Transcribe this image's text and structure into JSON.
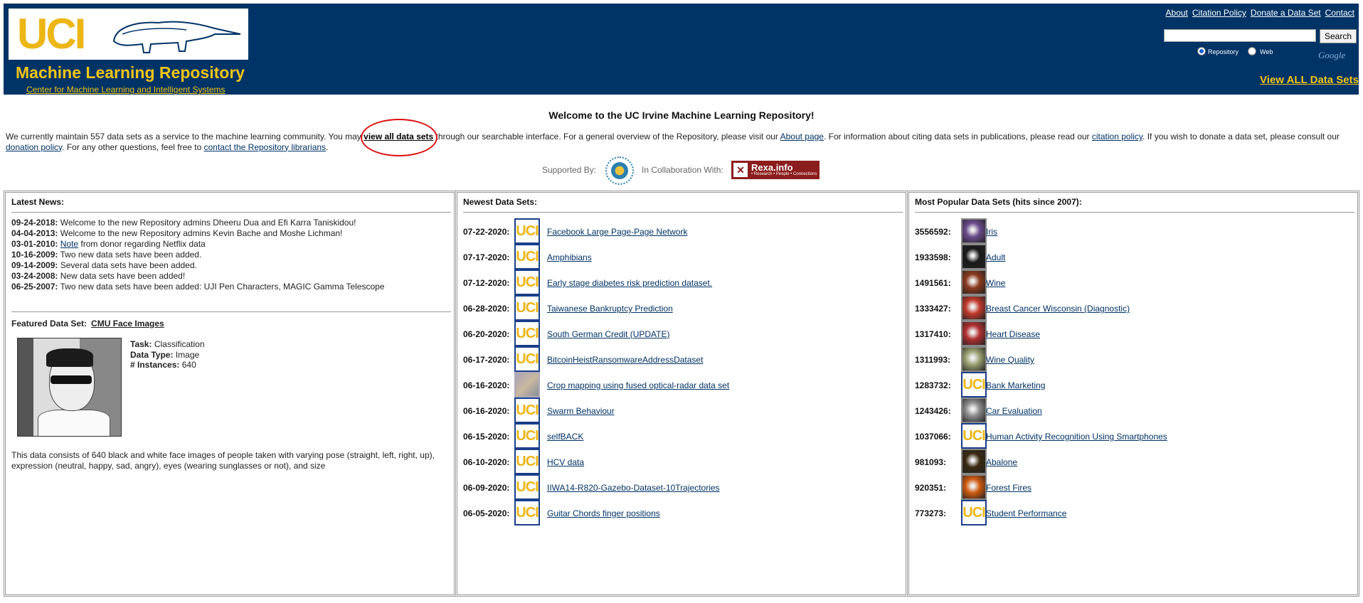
{
  "header": {
    "logo_text": "UCI",
    "title": "Machine Learning Repository",
    "subtitle": "Center for Machine Learning and Intelligent Systems",
    "links": [
      "About",
      "Citation Policy",
      "Donate a Data Set",
      "Contact"
    ],
    "search": {
      "button": "Search",
      "radio_repository": "Repository",
      "radio_web": "Web",
      "google": "Google"
    },
    "view_all": "View ALL Data Sets"
  },
  "welcome": "Welcome to the UC Irvine Machine Learning Repository!",
  "intro": {
    "t1": "We currently maintain 557 data sets as a service to the machine learning community. You may ",
    "link1": "view all data sets",
    "t2": " through our searchable interface. For a general overview of the Repository, please visit our ",
    "link2": "About page",
    "t3": ". For information about citing data sets in publications, please read our ",
    "link3": "citation policy",
    "t4": ". If you wish to donate a data set, please consult our ",
    "link4": "donation policy",
    "t5": ". For any other questions, feel free to ",
    "link5": "contact the Repository librarians",
    "t6": "."
  },
  "support": {
    "supported_by": "Supported By:",
    "collab": "In Collaboration With:",
    "rexa_title": "Rexa.info",
    "rexa_sub": "• Research • People • Connections"
  },
  "news": {
    "title": "Latest News:",
    "items": [
      {
        "date": "09-24-2018:",
        "text": " Welcome to the new Repository admins Dheeru Dua and Efi Karra Taniskidou!"
      },
      {
        "date": "04-04-2013:",
        "text": " Welcome to the new Repository admins Kevin Bache and Moshe Lichman!"
      },
      {
        "date": "03-01-2010:",
        "link": "Note",
        "text": " from donor regarding Netflix data"
      },
      {
        "date": "10-16-2009:",
        "text": " Two new data sets have been added."
      },
      {
        "date": "09-14-2009:",
        "text": " Several data sets have been added."
      },
      {
        "date": "03-24-2008:",
        "text": " New data sets have been added!"
      },
      {
        "date": "06-25-2007:",
        "text": " Two new data sets have been added: UJI Pen Characters, MAGIC Gamma Telescope"
      }
    ]
  },
  "featured": {
    "label": "Featured Data Set:",
    "name": "CMU Face Images",
    "task_label": "Task:",
    "task": "Classification",
    "type_label": "Data Type:",
    "type": "Image",
    "inst_label": "# Instances:",
    "instances": "640",
    "description": "This data consists of 640 black and white face images of people taken with varying pose (straight, left, right, up), expression (neutral, happy, sad, angry), eyes (wearing sunglasses or not), and size"
  },
  "newest": {
    "title": "Newest Data Sets:",
    "items": [
      {
        "date": "07-22-2020:",
        "name": "Facebook Large Page-Page Network",
        "thumb": "uci"
      },
      {
        "date": "07-17-2020:",
        "name": "Amphibians",
        "thumb": "uci"
      },
      {
        "date": "07-12-2020:",
        "name": "Early stage diabetes risk prediction dataset.",
        "thumb": "uci"
      },
      {
        "date": "06-28-2020:",
        "name": "Taiwanese Bankruptcy Prediction",
        "thumb": "uci"
      },
      {
        "date": "06-20-2020:",
        "name": "South German Credit (UPDATE)",
        "thumb": "uci"
      },
      {
        "date": "06-17-2020:",
        "name": "BitcoinHeistRansomwareAddressDataset",
        "thumb": "uci"
      },
      {
        "date": "06-16-2020:",
        "name": "Crop mapping using fused optical-radar data set",
        "thumb": "crop-image"
      },
      {
        "date": "06-16-2020:",
        "name": "Swarm Behaviour",
        "thumb": "uci"
      },
      {
        "date": "06-15-2020:",
        "name": "selfBACK",
        "thumb": "uci"
      },
      {
        "date": "06-10-2020:",
        "name": "HCV data",
        "thumb": "uci"
      },
      {
        "date": "06-09-2020:",
        "name": "IIWA14-R820-Gazebo-Dataset-10Trajectories",
        "thumb": "uci"
      },
      {
        "date": "06-05-2020:",
        "name": "Guitar Chords finger positions",
        "thumb": "uci"
      }
    ]
  },
  "popular": {
    "title": "Most Popular Data Sets (hits since 2007):",
    "items": [
      {
        "hits": "3556592:",
        "name": "Iris",
        "thumb": "iris-image",
        "color": "#6b4c8c"
      },
      {
        "hits": "1933598:",
        "name": "Adult",
        "thumb": "adult-image",
        "color": "#1a1a1a"
      },
      {
        "hits": "1491561:",
        "name": "Wine",
        "thumb": "wine-image",
        "color": "#8a3a1e"
      },
      {
        "hits": "1333427:",
        "name": "Breast Cancer Wisconsin (Diagnostic)",
        "thumb": "tree-image",
        "color": "#c0392b"
      },
      {
        "hits": "1317410:",
        "name": "Heart Disease",
        "thumb": "heart-image",
        "color": "#b03030"
      },
      {
        "hits": "1311993:",
        "name": "Wine Quality",
        "thumb": "wine-quality-image",
        "color": "#9aa070"
      },
      {
        "hits": "1283732:",
        "name": "Bank Marketing",
        "thumb": "uci"
      },
      {
        "hits": "1243426:",
        "name": "Car Evaluation",
        "thumb": "car-image",
        "color": "#8a8a8a"
      },
      {
        "hits": "1037066:",
        "name": "Human Activity Recognition Using Smartphones",
        "thumb": "uci"
      },
      {
        "hits": "981093:",
        "name": "Abalone",
        "thumb": "abalone-image",
        "color": "#3a2a10"
      },
      {
        "hits": "920351:",
        "name": "Forest Fires",
        "thumb": "fire-image",
        "color": "#d05a10"
      },
      {
        "hits": "773273:",
        "name": "Student Performance",
        "thumb": "uci"
      }
    ]
  }
}
